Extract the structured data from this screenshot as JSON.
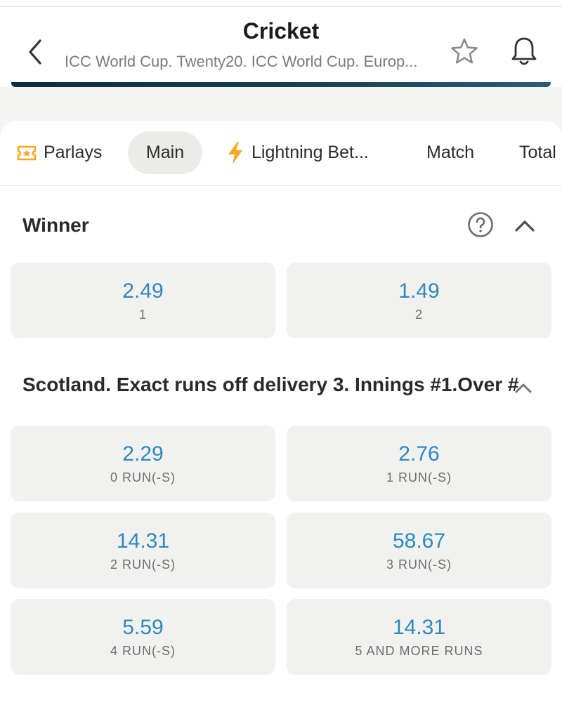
{
  "header": {
    "title": "Cricket",
    "subtitle": "ICC World Cup. Twenty20. ICC World Cup. Europ..."
  },
  "tabs": [
    {
      "label": "Parlays",
      "icon": "ticket-icon"
    },
    {
      "label": "Main",
      "active": true
    },
    {
      "label": "Lightning Bet...",
      "icon": "lightning-icon"
    },
    {
      "label": "Match"
    },
    {
      "label": "Total"
    }
  ],
  "markets": [
    {
      "title": "Winner",
      "outcomes": [
        {
          "odds": "2.49",
          "label": "1"
        },
        {
          "odds": "1.49",
          "label": "2"
        }
      ]
    },
    {
      "title": "Scotland. Exact runs off delivery 3. Innings #1.Over #",
      "outcomes": [
        {
          "odds": "2.29",
          "label": "0 RUN(-S)"
        },
        {
          "odds": "2.76",
          "label": "1 RUN(-S)"
        },
        {
          "odds": "14.31",
          "label": "2 RUN(-S)"
        },
        {
          "odds": "58.67",
          "label": "3 RUN(-S)"
        },
        {
          "odds": "5.59",
          "label": "4 RUN(-S)"
        },
        {
          "odds": "14.31",
          "label": "5 AND MORE RUNS"
        }
      ]
    }
  ],
  "colors": {
    "accent_odds": "#2e88bf",
    "card_bg": "#f1f1ef",
    "tab_icon_orange": "#f5a623",
    "banner": "#173f55"
  }
}
